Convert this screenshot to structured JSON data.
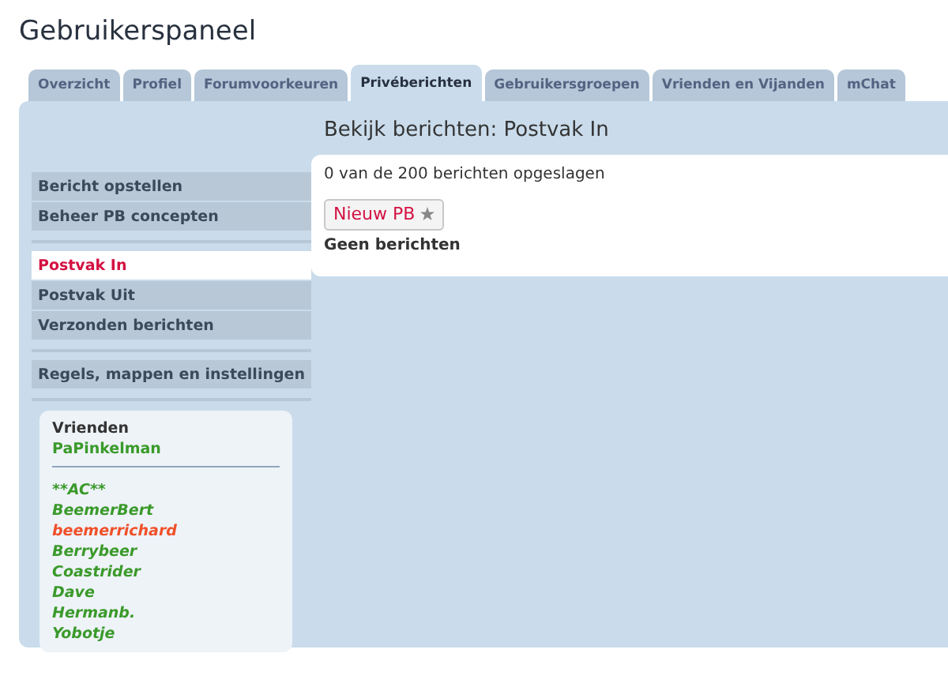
{
  "page_title": "Gebruikerspaneel",
  "tabs": [
    {
      "label": "Overzicht",
      "selected": false
    },
    {
      "label": "Profiel",
      "selected": false
    },
    {
      "label": "Forumvoorkeuren",
      "selected": false
    },
    {
      "label": "Privéberichten",
      "selected": true
    },
    {
      "label": "Gebruikersgroepen",
      "selected": false
    },
    {
      "label": "Vrienden en Vijanden",
      "selected": false
    },
    {
      "label": "mChat",
      "selected": false
    }
  ],
  "menu_groups": [
    [
      {
        "label": "Bericht opstellen",
        "selected": false
      },
      {
        "label": "Beheer PB concepten",
        "selected": false
      }
    ],
    [
      {
        "label": "Postvak In",
        "selected": true
      },
      {
        "label": "Postvak Uit",
        "selected": false
      },
      {
        "label": "Verzonden berichten",
        "selected": false
      }
    ],
    [
      {
        "label": "Regels, mappen en instellingen",
        "selected": false
      }
    ]
  ],
  "friends": {
    "title": "Vrienden",
    "online": [
      {
        "name": "PaPinkelman",
        "color": "#3a9a2a"
      }
    ],
    "offline": [
      {
        "name": "**AC**",
        "color": "#3a9a2a"
      },
      {
        "name": "BeemerBert",
        "color": "#3a9a2a"
      },
      {
        "name": "beemerrichard",
        "color": "#f0502a"
      },
      {
        "name": "Berrybeer",
        "color": "#3a9a2a"
      },
      {
        "name": "Coastrider",
        "color": "#3a9a2a"
      },
      {
        "name": "Dave",
        "color": "#3a9a2a"
      },
      {
        "name": "Hermanb.",
        "color": "#3a9a2a"
      },
      {
        "name": "Yobotje",
        "color": "#3a9a2a"
      }
    ]
  },
  "content": {
    "heading": "Bekijk berichten: Postvak In",
    "storage": "0 van de 200 berichten opgeslagen",
    "new_button": "Nieuw PB",
    "empty": "Geen berichten"
  }
}
